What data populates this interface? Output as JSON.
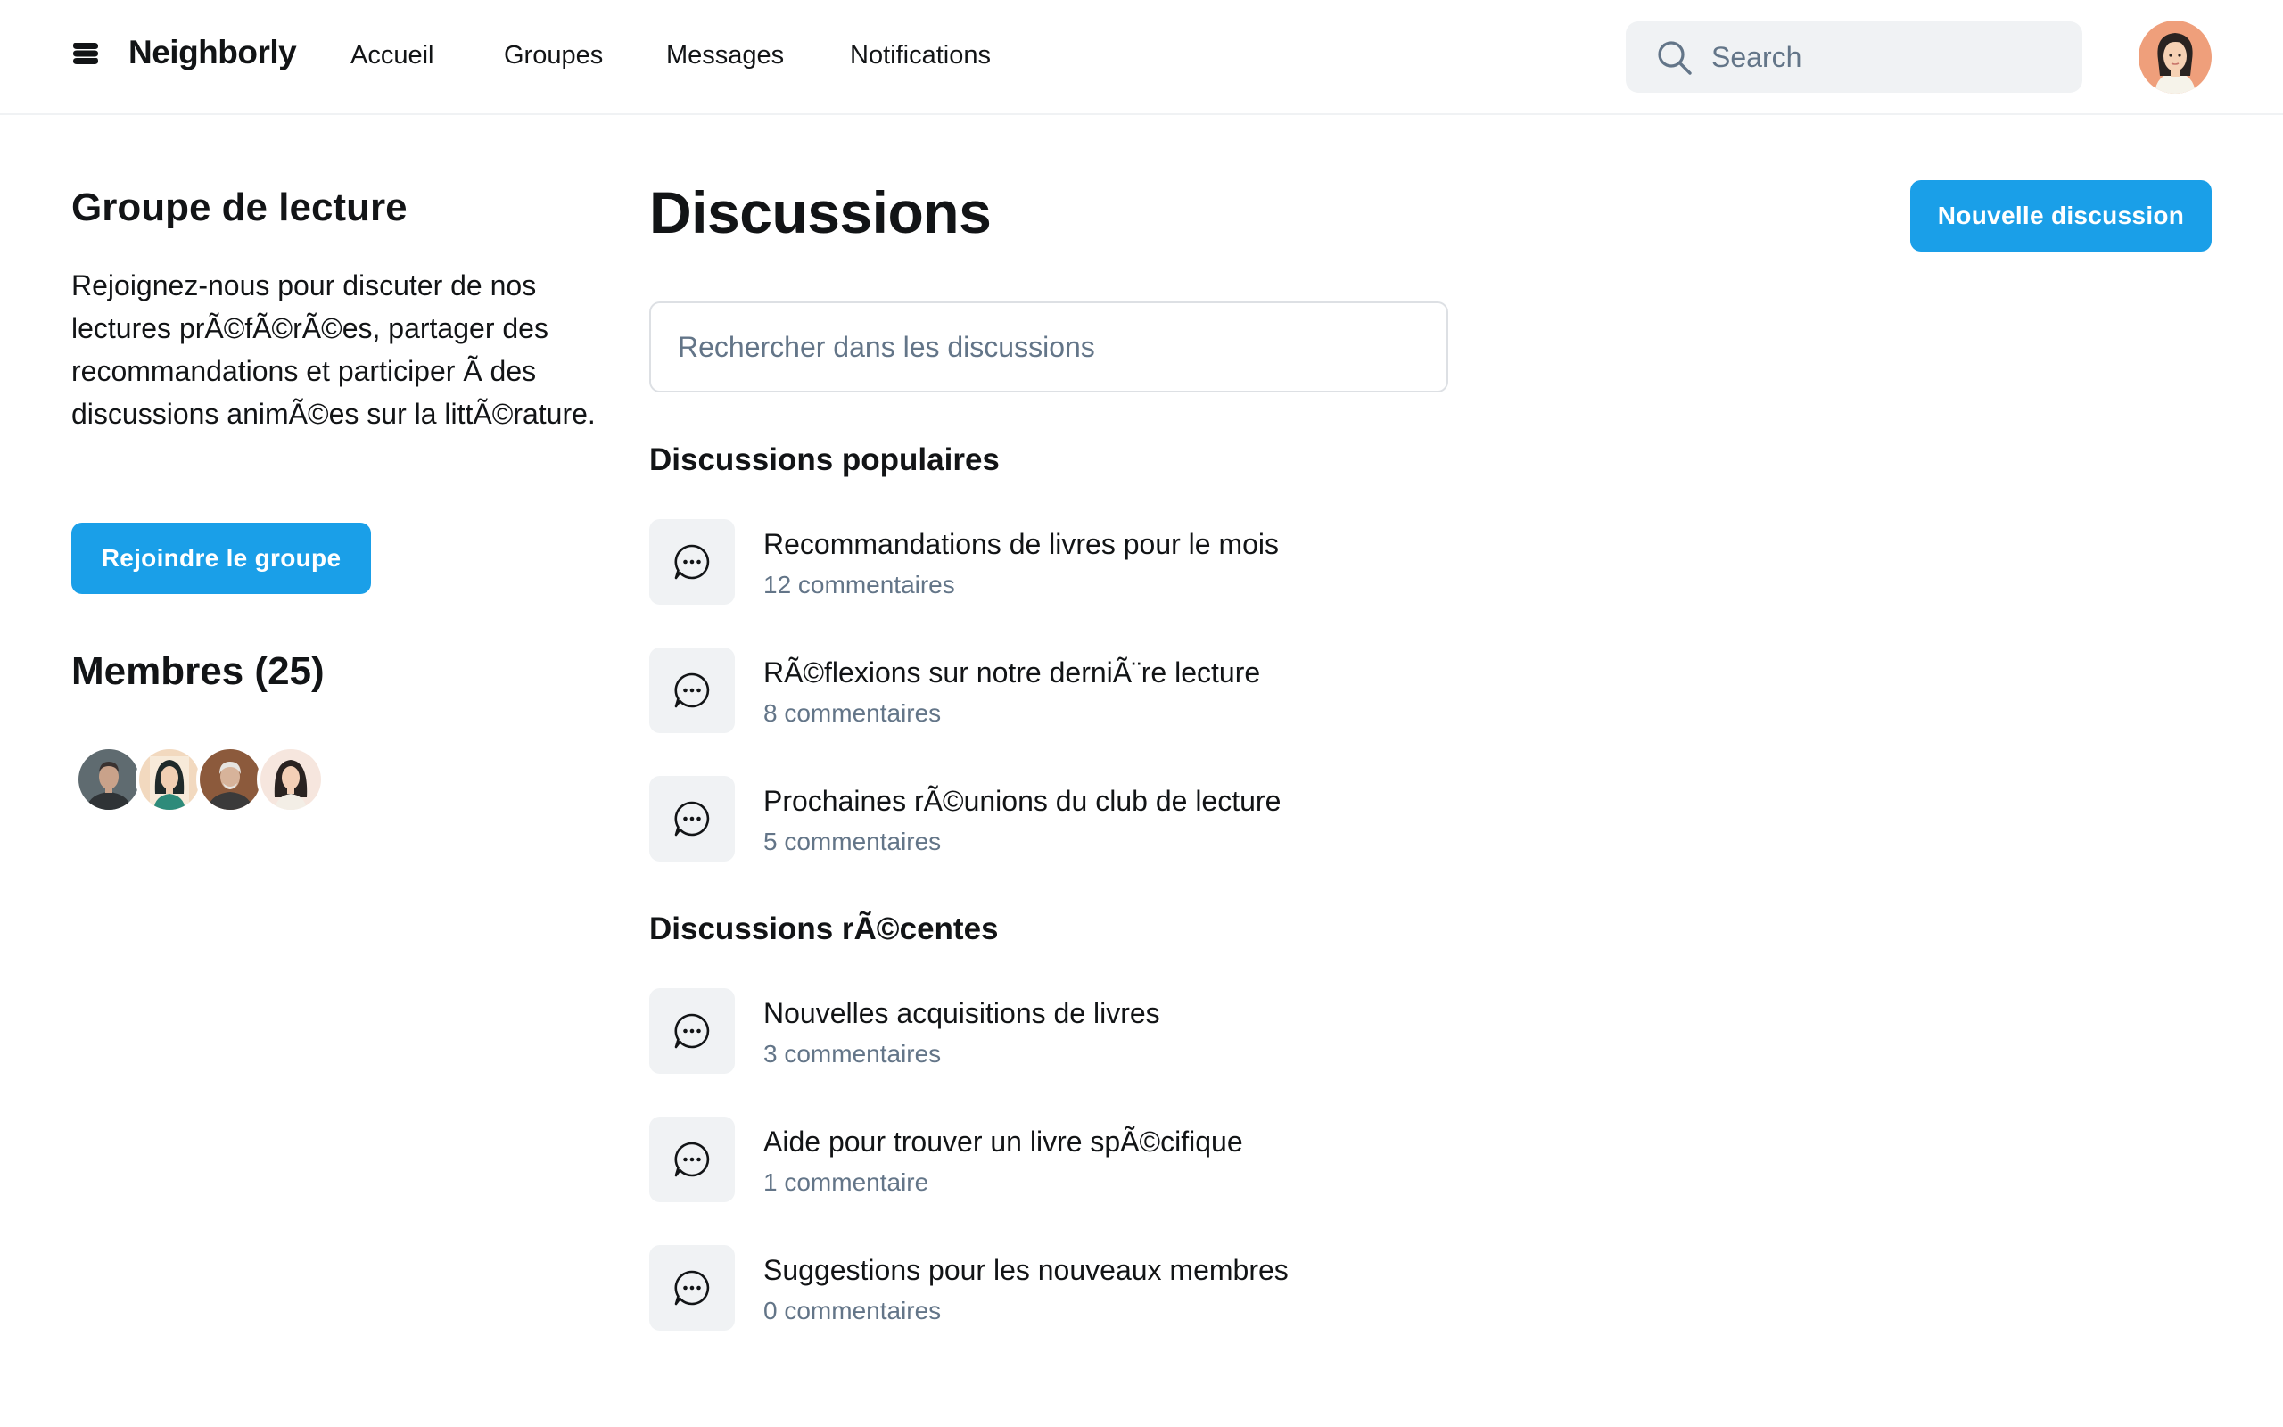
{
  "header": {
    "brand": "Neighborly",
    "nav": [
      "Accueil",
      "Groupes",
      "Messages",
      "Notifications"
    ],
    "search_placeholder": "Search"
  },
  "sidebar": {
    "group_title": "Groupe de lecture",
    "description": "Rejoignez-nous pour discuter de nos lectures prÃ©fÃ©rÃ©es, partager des recommandations et participer Ã  des discussions animÃ©es sur la littÃ©rature.",
    "join_label": "Rejoindre le groupe",
    "members_title": "Membres (25)"
  },
  "main": {
    "title": "Discussions",
    "new_label": "Nouvelle discussion",
    "search_placeholder": "Rechercher dans les discussions",
    "popular_title": "Discussions populaires",
    "popular": [
      {
        "title": "Recommandations de livres pour le mois",
        "count": "12 commentaires"
      },
      {
        "title": "RÃ©flexions sur notre derniÃ¨re lecture",
        "count": "8 commentaires"
      },
      {
        "title": "Prochaines rÃ©unions du club de lecture",
        "count": "5 commentaires"
      }
    ],
    "recent_title": "Discussions rÃ©centes",
    "recent": [
      {
        "title": "Nouvelles acquisitions de livres",
        "count": "3 commentaires"
      },
      {
        "title": "Aide pour trouver un livre spÃ©cifique",
        "count": "1 commentaire"
      },
      {
        "title": "Suggestions pour les nouveaux membres",
        "count": "0 commentaires"
      }
    ]
  },
  "colors": {
    "accent": "#1a9fe8",
    "muted_text": "#637588",
    "surface": "#f0f2f4"
  },
  "icons": {
    "logo": "neighborly-logo-icon",
    "search": "search-icon",
    "discussion": "chat-bubble-icon"
  }
}
